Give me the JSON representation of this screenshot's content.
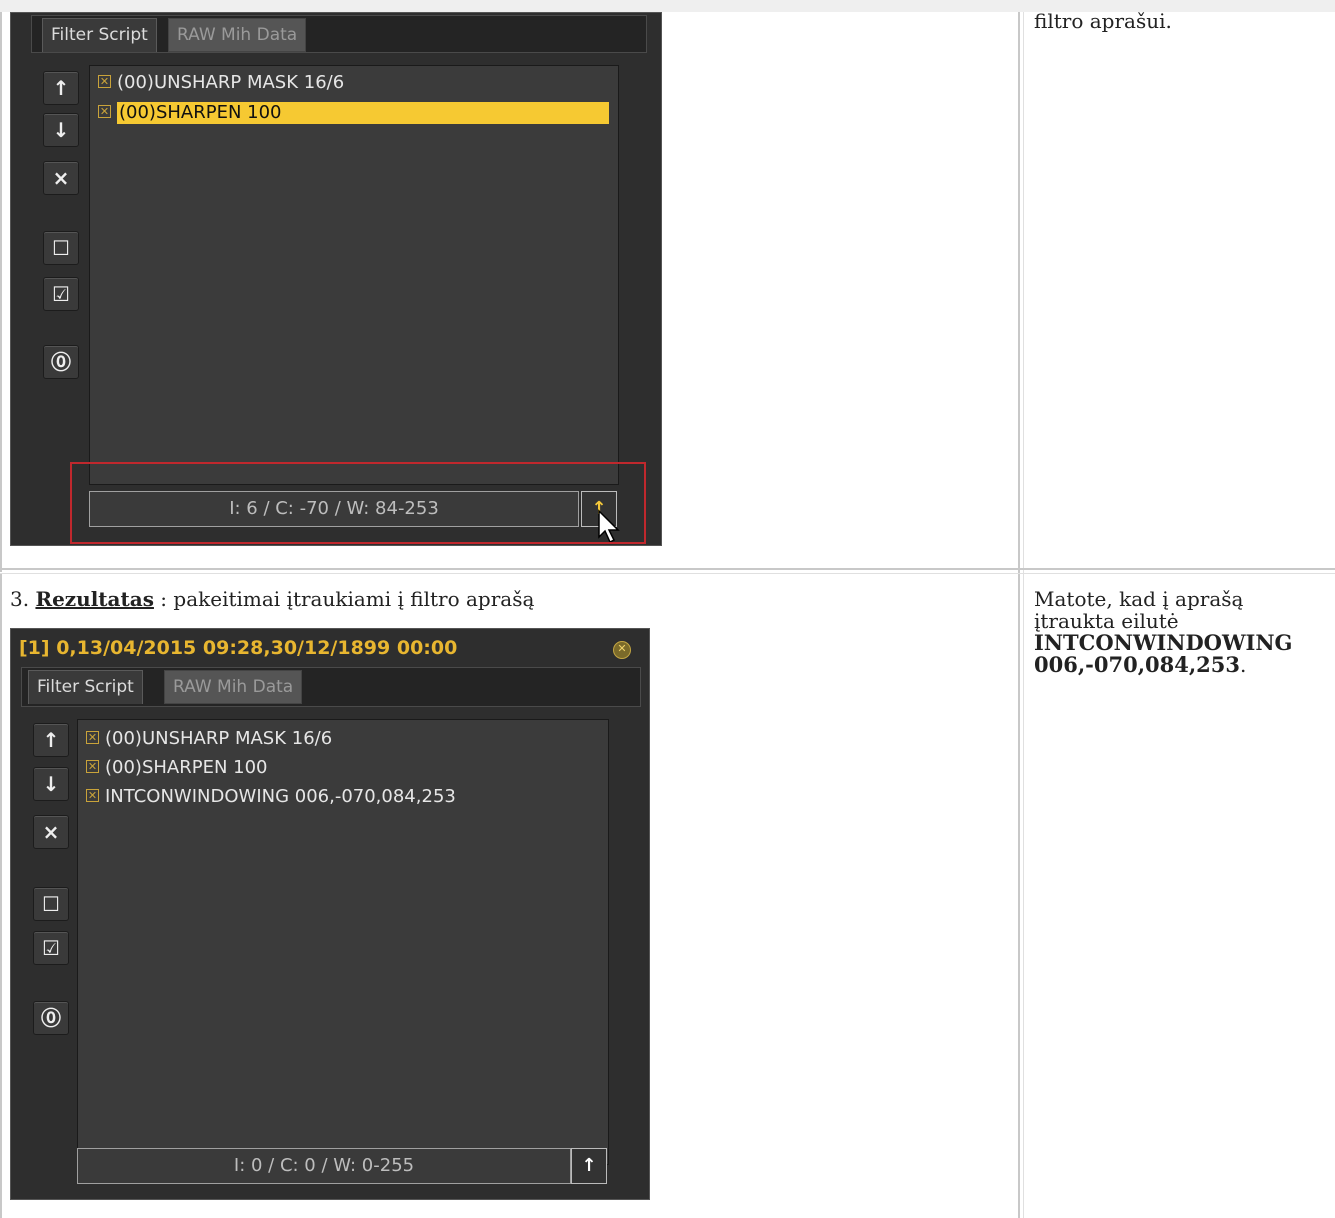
{
  "top_row": {
    "right_text": "filtro aprašui."
  },
  "panel1": {
    "tabs": [
      "Filter Script",
      "RAW Mih Data"
    ],
    "side_buttons": [
      "↑",
      "↓",
      "×",
      "☐",
      "☑",
      "⓪"
    ],
    "rows": [
      {
        "label": "(00)UNSHARP MASK 16/6",
        "highlighted": false
      },
      {
        "label": "(00)SHARPEN 100",
        "highlighted": true
      }
    ],
    "status": "I: 6 / C: -70 / W: 84-253",
    "apply_glyph": "↑",
    "highlight_color": "#f6c932",
    "red_box_color": "#c0282d"
  },
  "step3": {
    "number": "3.",
    "heading": "Rezultatas",
    "text": " : pakeitimai įtraukiami į filtro aprašą"
  },
  "panel2": {
    "title": "[1] 0,13/04/2015 09:28,30/12/1899 00:00",
    "tabs": [
      "Filter Script",
      "RAW Mih Data"
    ],
    "side_buttons": [
      "↑",
      "↓",
      "×",
      "☐",
      "☑",
      "⓪"
    ],
    "rows": [
      {
        "label": "(00)UNSHARP MASK 16/6"
      },
      {
        "label": "(00)SHARPEN 100"
      },
      {
        "label": "INTCONWINDOWING 006,-070,084,253"
      }
    ],
    "status": "I: 0 / C: 0 / W: 0-255",
    "apply_glyph": "↑",
    "title_color": "#e8b630"
  },
  "right_note": {
    "line1": "Matote, kad į aprašą",
    "line2": "įtraukta eilutė",
    "bold1": "INTCONWINDOWING",
    "bold2": "006,-070,084,253",
    "tail": "."
  }
}
